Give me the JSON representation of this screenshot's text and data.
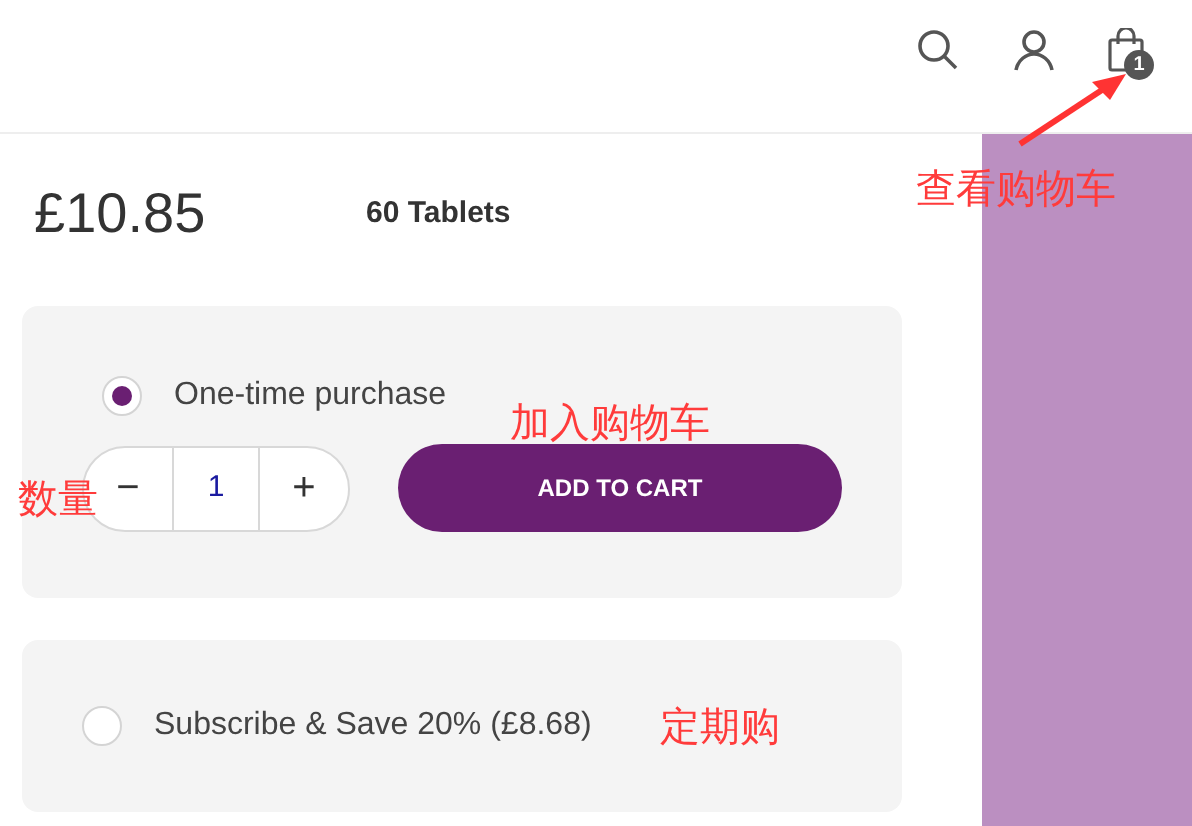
{
  "header": {
    "cart_count": "1"
  },
  "product": {
    "price": "£10.85",
    "pack_size": "60 Tablets"
  },
  "purchase_options": [
    {
      "label": "One-time purchase",
      "selected": true
    },
    {
      "label": "Subscribe & Save 20% (£8.68)",
      "selected": false
    }
  ],
  "quantity": {
    "value": "1",
    "decrease": "−",
    "increase": "+"
  },
  "add_to_cart": "ADD TO CART",
  "annotations": {
    "cart": "查看购物车",
    "add_to_cart": "加入购物车",
    "quantity": "数量",
    "subscribe": "定期购"
  }
}
